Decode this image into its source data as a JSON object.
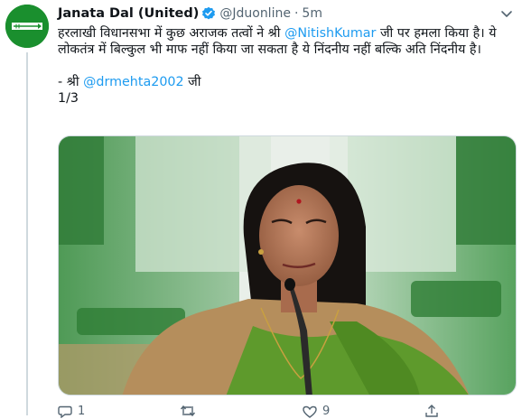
{
  "tweet": {
    "author_name": "Janata Dal (United)",
    "handle": "@Jduonline",
    "separator": "·",
    "time": "5m",
    "text_line1_pre": "हरलाखी विधानसभा में कुछ अराजक तत्वों ने श्री ",
    "mention1": "@NitishKumar",
    "text_line1_post": " जी पर हमला किया है।",
    "text_line2": "ये लोकतंत्र में बिल्कुल भी माफ नहीं किया जा सकता है ये निंदनीय नहीं बल्कि अति निंदनीय है।",
    "sign_pre": "- श्री ",
    "mention2": "@drmehta2002",
    "sign_post": " जी",
    "thread_count": "1/3"
  },
  "actions": {
    "reply_count": "1",
    "retweet_count": "",
    "like_count": "9"
  },
  "colors": {
    "accent": "#1d9bf0",
    "avatar_bg": "#1a8f2e",
    "verified": "#1d9bf0",
    "saree": "#5e9a2c"
  },
  "icons": [
    "verified-badge-icon",
    "more-caret-icon",
    "reply-icon",
    "retweet-icon",
    "like-icon",
    "share-icon"
  ]
}
